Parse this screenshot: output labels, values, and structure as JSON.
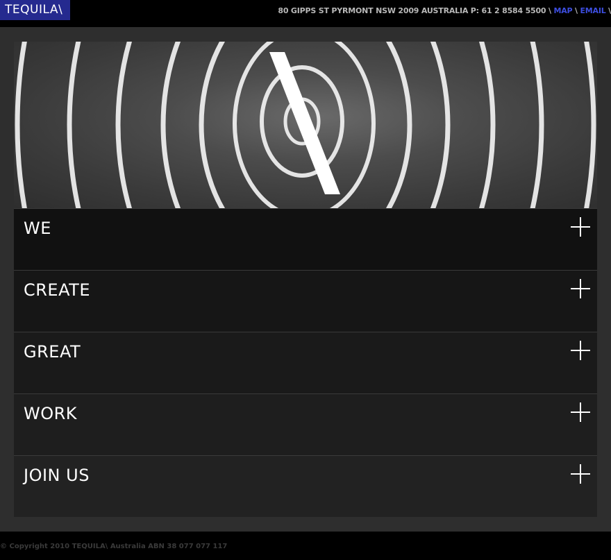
{
  "header": {
    "logo_text": "TEQUILA\\",
    "address_text": "80 GIPPS ST PYRMONT NSW 2009 AUSTRALIA P: 61 2 8584 5500 \\ ",
    "map_link": "MAP",
    "separator": " \\ ",
    "email_link": "EMAIL",
    "trailing": " \\"
  },
  "hero": {
    "image_description_icon": "spiral-backslash-artwork"
  },
  "accordion": {
    "items": [
      {
        "label": "WE",
        "background": "#111111"
      },
      {
        "label": "CREATE",
        "background": "#161616"
      },
      {
        "label": "GREAT",
        "background": "#1a1a1a"
      },
      {
        "label": "WORK",
        "background": "#1e1e1e"
      },
      {
        "label": "JOIN US",
        "background": "#222222"
      }
    ],
    "expand_icon": "plus-icon"
  },
  "footer": {
    "copyright": "© Copyright 2010 TEQUILA\\ Australia ABN 38 077 077 117"
  },
  "colors": {
    "logo_bg": "#252a8f",
    "link": "#3d4ee0",
    "page_bg": "#000000",
    "frame_bg": "#2e2e2e"
  }
}
